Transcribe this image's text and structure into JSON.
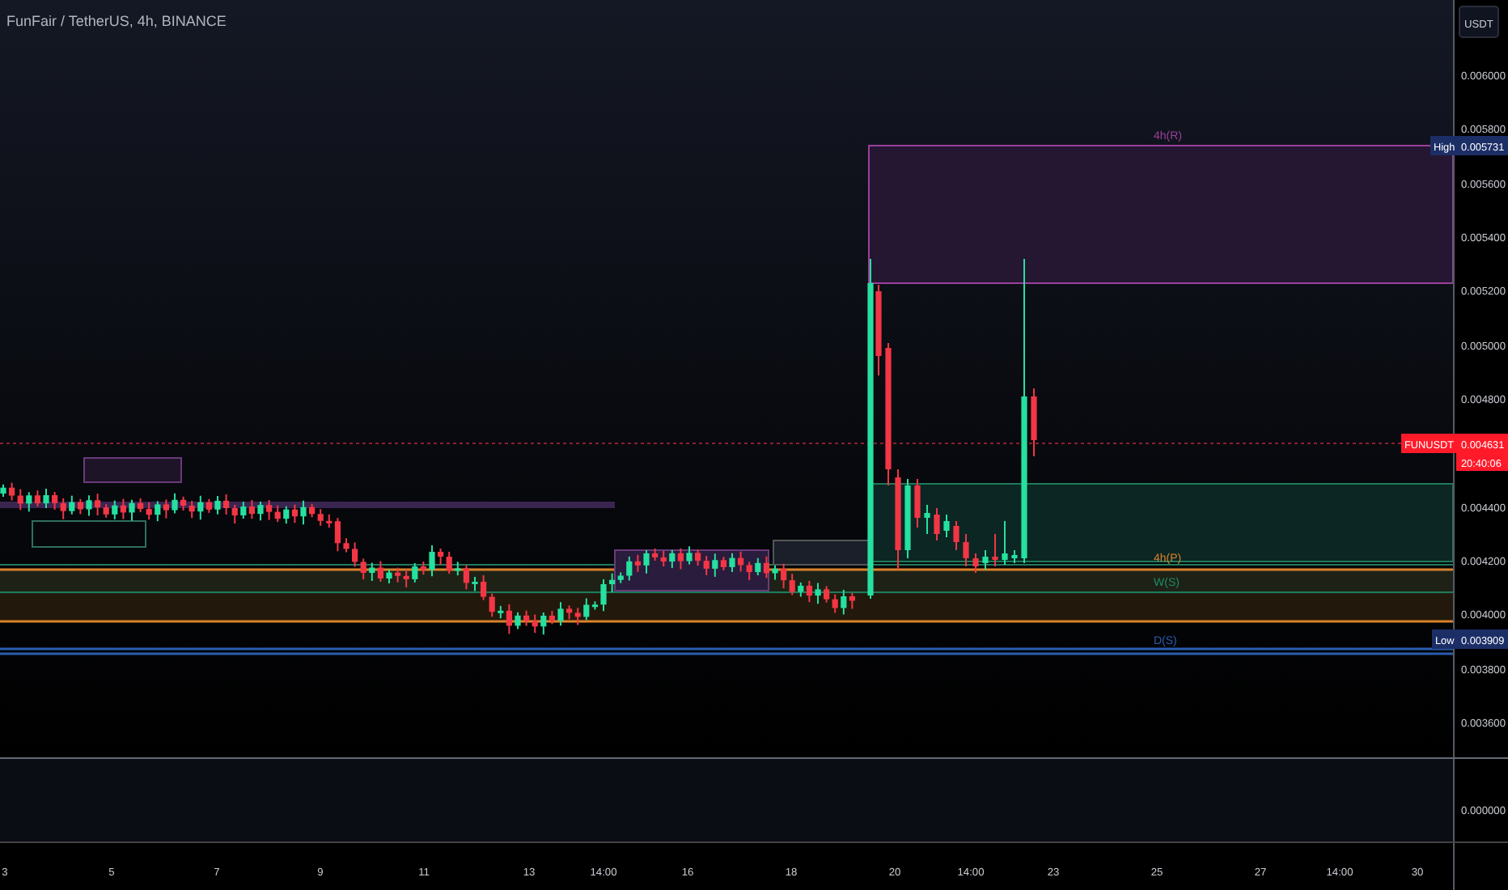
{
  "title": "FunFair / TetherUS, 4h, BINANCE",
  "currency": "USDT",
  "price_ticks": [
    "0.006000",
    "0.005800",
    "0.005600",
    "0.005400",
    "0.005200",
    "0.005000",
    "0.004800",
    "0.004400",
    "0.004200",
    "0.004000",
    "0.003800",
    "0.003600"
  ],
  "indicator_tick": "0.000000",
  "time_ticks": [
    "3",
    "5",
    "7",
    "9",
    "11",
    "13",
    "14:00",
    "16",
    "18",
    "20",
    "14:00",
    "23",
    "25",
    "27",
    "14:00",
    "30"
  ],
  "high_tag": {
    "label": "High",
    "value": "0.005731"
  },
  "low_tag": {
    "label": "Low",
    "value": "0.003909"
  },
  "last_price": {
    "symbol": "FUNUSDT",
    "value": "0.004631",
    "countdown": "20:40:06"
  },
  "zone_labels": [
    {
      "text": "4h(R)",
      "color": "#9c3f9c"
    },
    {
      "text": "4h(P)",
      "color": "#d9822b"
    },
    {
      "text": "W(S)",
      "color": "#1f8a6a"
    },
    {
      "text": "D(S)",
      "color": "#2a5db0"
    }
  ]
}
